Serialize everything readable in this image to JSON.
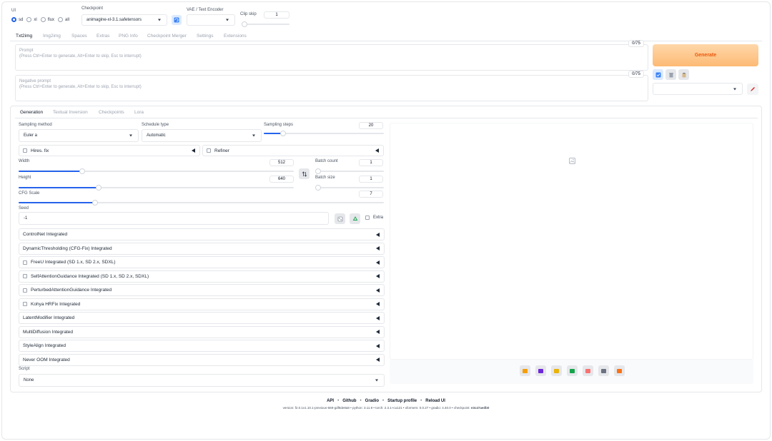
{
  "ui_group": {
    "label": "UI",
    "options": [
      "sd",
      "xl",
      "flux",
      "all"
    ],
    "selected": "sd"
  },
  "checkpoint": {
    "label": "Checkpoint",
    "value": "animagine-xl-3.1.safetensors"
  },
  "vae": {
    "label": "VAE / Text Encoder",
    "value": ""
  },
  "clip_skip": {
    "label": "Clip skip",
    "value": "1",
    "level_fraction": 0.0
  },
  "main_tabs": [
    "Txt2img",
    "Img2img",
    "Spaces",
    "Extras",
    "PNG Info",
    "Checkpoint Merger",
    "Settings",
    "Extensions"
  ],
  "active_main_tab": "Txt2img",
  "prompt": {
    "label": "Prompt",
    "placeholder": "(Press Ctrl+Enter to generate, Alt+Enter to skip, Esc to interrupt)",
    "token_count": "0/75"
  },
  "negative_prompt": {
    "label": "Negative prompt",
    "placeholder": "(Press Ctrl+Enter to generate, Alt+Enter to skip, Esc to interrupt)",
    "token_count": "0/75"
  },
  "generate_label": "Generate",
  "styles_value": "",
  "sub_tabs": [
    "Generation",
    "Textual Inversion",
    "Checkpoints",
    "Lora"
  ],
  "active_sub_tab": "Generation",
  "sampling_method": {
    "label": "Sampling method",
    "value": "Euler a"
  },
  "schedule_type": {
    "label": "Schedule type",
    "value": "Automatic"
  },
  "sampling_steps": {
    "label": "Sampling steps",
    "value": "20",
    "level_fraction": 0.16
  },
  "hires_fix": {
    "label": "Hires. fix"
  },
  "refiner": {
    "label": "Refiner"
  },
  "width": {
    "label": "Width",
    "value": "512",
    "level_fraction": 0.23
  },
  "height": {
    "label": "Height",
    "value": "640",
    "level_fraction": 0.29
  },
  "batch_count": {
    "label": "Batch count",
    "value": "1",
    "level_fraction": 0.0
  },
  "batch_size": {
    "label": "Batch size",
    "value": "1",
    "level_fraction": 0.0
  },
  "cfg_scale": {
    "label": "CFG Scale",
    "value": "7",
    "level_fraction": 0.21
  },
  "seed": {
    "label": "Seed",
    "value": "-1",
    "extra_label": "Extra"
  },
  "accordions": [
    {
      "label": "ControlNet Integrated",
      "checkbox": false
    },
    {
      "label": "DynamicThresholding (CFG-Fix) Integrated",
      "checkbox": false
    },
    {
      "label": "FreeU Integrated (SD 1.x, SD 2.x, SDXL)",
      "checkbox": true
    },
    {
      "label": "SelfAttentionGuidance Integrated (SD 1.x, SD 2.x, SDXL)",
      "checkbox": true
    },
    {
      "label": "PerturbedAttentionGuidance Integrated",
      "checkbox": true
    },
    {
      "label": "Kohya HRFix Integrated",
      "checkbox": true
    },
    {
      "label": "LatentModifier Integrated",
      "checkbox": false
    },
    {
      "label": "MultiDiffusion Integrated",
      "checkbox": false
    },
    {
      "label": "StyleAlign Integrated",
      "checkbox": false
    },
    {
      "label": "Never OOM Integrated",
      "checkbox": false
    }
  ],
  "script": {
    "label": "Script",
    "value": "None"
  },
  "output_icons": [
    "folder-icon",
    "save-icon",
    "zip-icon",
    "image-send-icon",
    "palette-icon",
    "extras-icon",
    "star-icon"
  ],
  "footer": {
    "links": [
      "API",
      "Github",
      "Gradio",
      "Startup profile",
      "Reload UI"
    ],
    "version_text": "version: f2.0.1v1.10.1-previous-669-gdf8de8a8  •  python: 3.11.9  •  torch: 2.3.1+cu121  •  xformers: 0.0.27  •  gradio: 4.40.0  •  checkpoint: ",
    "checkpoint_hash": "e3c47aedb0"
  },
  "colors": {
    "accent": "#2563eb",
    "generate_bg": "#fdba74",
    "generate_text": "#ea580c"
  }
}
